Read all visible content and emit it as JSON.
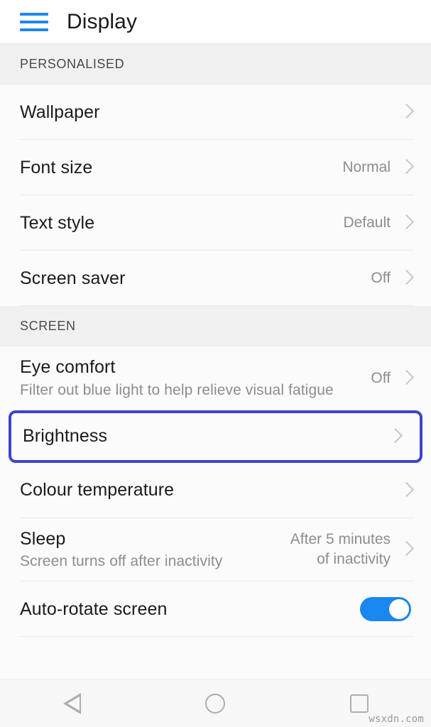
{
  "appbar": {
    "title": "Display",
    "menu_icon": "hamburger-menu-icon"
  },
  "colors": {
    "menu_icon": "#1e88f0",
    "highlight_border": "#3f43ce",
    "toggle_on": "#1a86f0",
    "section_band": "#f0f0f0",
    "chevron": "#c6c6c6"
  },
  "sections": [
    {
      "label": "PERSONALISED",
      "rows": [
        {
          "name": "wallpaper",
          "title": "Wallpaper",
          "subtitle": "",
          "value": "",
          "control": "chevron"
        },
        {
          "name": "font-size",
          "title": "Font size",
          "subtitle": "",
          "value": "Normal",
          "control": "chevron"
        },
        {
          "name": "text-style",
          "title": "Text style",
          "subtitle": "",
          "value": "Default",
          "control": "chevron"
        },
        {
          "name": "screen-saver",
          "title": "Screen saver",
          "subtitle": "",
          "value": "Off",
          "control": "chevron"
        }
      ]
    },
    {
      "label": "SCREEN",
      "rows": [
        {
          "name": "eye-comfort",
          "title": "Eye comfort",
          "subtitle": "Filter out blue light to help relieve visual fatigue",
          "value": "Off",
          "control": "chevron"
        },
        {
          "name": "brightness",
          "title": "Brightness",
          "subtitle": "",
          "value": "",
          "control": "chevron",
          "highlighted": true
        },
        {
          "name": "colour-temperature",
          "title": "Colour temperature",
          "subtitle": "",
          "value": "",
          "control": "chevron"
        },
        {
          "name": "sleep",
          "title": "Sleep",
          "subtitle": "Screen turns off after inactivity",
          "value": "After 5 minutes\nof inactivity",
          "control": "chevron"
        },
        {
          "name": "auto-rotate-screen",
          "title": "Auto-rotate screen",
          "subtitle": "",
          "value": "",
          "control": "toggle",
          "toggle_on": true
        }
      ]
    }
  ],
  "navbar": {
    "back_label": "back-button",
    "home_label": "home-button",
    "recents_label": "recents-button"
  },
  "watermark": "wsxdn.com"
}
